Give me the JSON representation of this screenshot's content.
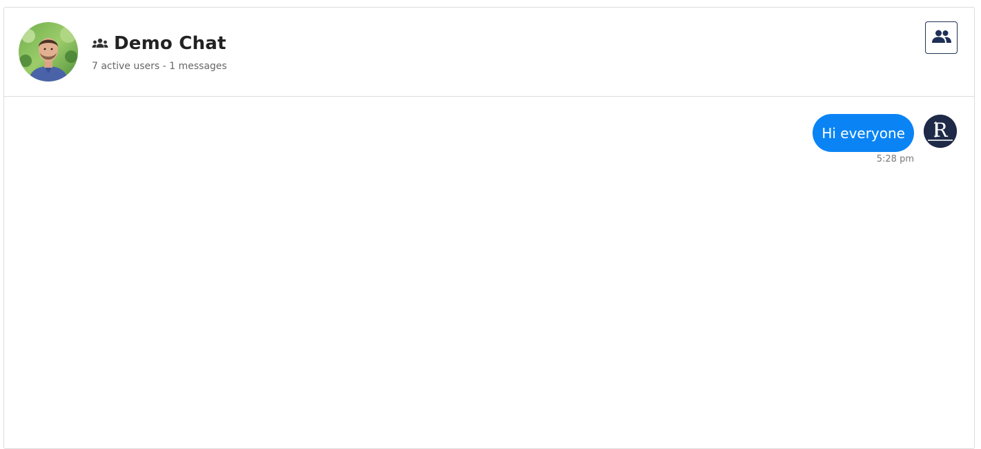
{
  "header": {
    "title": "Demo Chat",
    "subtitle": "7 active users - 1 messages",
    "group_icon": "group-icon",
    "members_button_icon": "users-icon"
  },
  "messages": [
    {
      "text": "Hi everyone",
      "time": "5:28 pm",
      "sender_avatar_initials": "R"
    }
  ],
  "colors": {
    "bubble": "#0a84f5",
    "brand_dark": "#1f2f55"
  }
}
